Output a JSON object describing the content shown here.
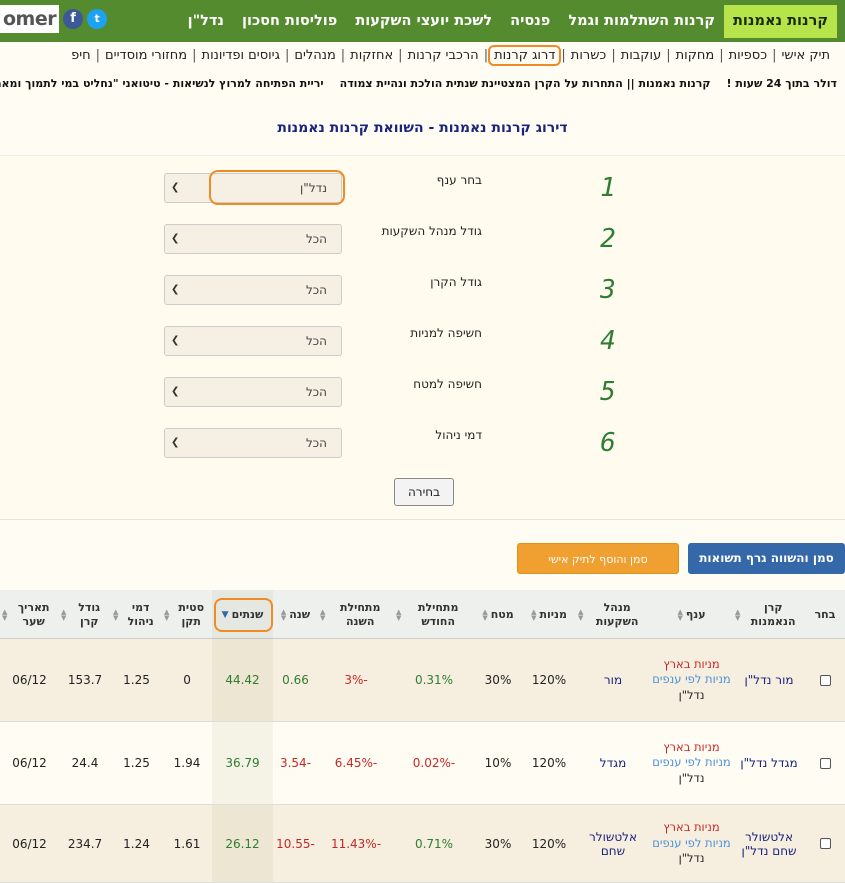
{
  "header": {
    "logo": "omer",
    "social_fb": "f",
    "social_tw": "t",
    "nav": [
      {
        "label": "קרנות נאמנות",
        "active": true
      },
      {
        "label": "קרנות השתלמות וגמל",
        "active": false
      },
      {
        "label": "פנסיה",
        "active": false
      },
      {
        "label": "לשכת יועצי השקעות",
        "active": false
      },
      {
        "label": "פוליסות חסכון",
        "active": false
      },
      {
        "label": "נדל\"ן",
        "active": false
      }
    ]
  },
  "subnav": [
    {
      "label": "תיק אישי",
      "highlight": false
    },
    {
      "label": "כספיות",
      "highlight": false
    },
    {
      "label": "מחקות",
      "highlight": false
    },
    {
      "label": "עוקבות",
      "highlight": false
    },
    {
      "label": "כשרות",
      "highlight": false
    },
    {
      "label": "דרוג קרנות",
      "highlight": true
    },
    {
      "label": "הרכבי קרנות",
      "highlight": false
    },
    {
      "label": "אחזקות",
      "highlight": false
    },
    {
      "label": "מנהלים",
      "highlight": false
    },
    {
      "label": "גיוסים ופדיונות",
      "highlight": false
    },
    {
      "label": "מחזורי מוסדיים",
      "highlight": false
    },
    {
      "label": "חיפ",
      "highlight": false
    }
  ],
  "ticker": [
    "דולר בתוך 24 שעות !",
    "קרנות נאמנות || התחרות על הקרן המצטיינת שנתית הולכת ונהיית צמודה",
    "יריית הפתיחה למרוץ לנשיאות - טיטואני \"נחליט במי לתמוך ומאמינים שהוא גם"
  ],
  "page_title": "דירוג קרנות נאמנות - השוואת קרנות נאמנות",
  "filters": [
    {
      "num": "1",
      "label": "בחר ענף",
      "value": "נדל\"ן"
    },
    {
      "num": "2",
      "label": "גודל מנהל השקעות",
      "value": "הכל"
    },
    {
      "num": "3",
      "label": "גודל הקרן",
      "value": "הכל"
    },
    {
      "num": "4",
      "label": "חשיפה למניות",
      "value": "הכל"
    },
    {
      "num": "5",
      "label": "חשיפה למטח",
      "value": "הכל"
    },
    {
      "num": "6",
      "label": "דמי ניהול",
      "value": "הכל"
    }
  ],
  "choose_button": "בחירה",
  "compare_button": "סמן והשווה גרף תשואות",
  "add_button": "סמן והוסף לתיק אישי",
  "table": {
    "headers": {
      "select": "בחר",
      "fund": "קרן הנאמנות",
      "branch": "ענף",
      "manager": "מנהל השקעות",
      "stocks": "מניות",
      "fx": "מטח",
      "month": "מתחילת החודש",
      "ytd": "מתחילת השנה",
      "year": "שנה",
      "years": "שנתים",
      "std": "סטית תקן",
      "fee": "דמי ניהול",
      "size": "גודל קרן",
      "date": "תאריך שער"
    },
    "rows": [
      {
        "fund": "מור נדל\"ן",
        "branch1": "מניות בארץ",
        "branch2": "מניות לפי ענפים",
        "branch3": "נדל\"ן",
        "manager": "מור",
        "stocks": "120%",
        "fx": "30%",
        "month": "0.31%",
        "ytd": "-3%",
        "year": "0.66",
        "years": "44.42",
        "std": "0",
        "fee": "1.25",
        "size": "153.7",
        "date": "06/12"
      },
      {
        "fund": "מגדל נדל\"ן",
        "branch1": "מניות בארץ",
        "branch2": "מניות לפי ענפים",
        "branch3": "נדל\"ן",
        "manager": "מגדל",
        "stocks": "120%",
        "fx": "10%",
        "month": "-0.02%",
        "ytd": "-6.45%",
        "year": "-3.54",
        "years": "36.79",
        "std": "1.94",
        "fee": "1.25",
        "size": "24.4",
        "date": "06/12"
      },
      {
        "fund": "אלטשולר שחם נדל\"ן",
        "branch1": "מניות בארץ",
        "branch2": "מניות לפי ענפים",
        "branch3": "נדל\"ן",
        "manager": "אלטשולר שחם",
        "stocks": "120%",
        "fx": "30%",
        "month": "0.71%",
        "ytd": "-11.43%",
        "year": "-10.55",
        "years": "26.12",
        "std": "1.61",
        "fee": "1.24",
        "size": "234.7",
        "date": "06/12"
      }
    ]
  }
}
